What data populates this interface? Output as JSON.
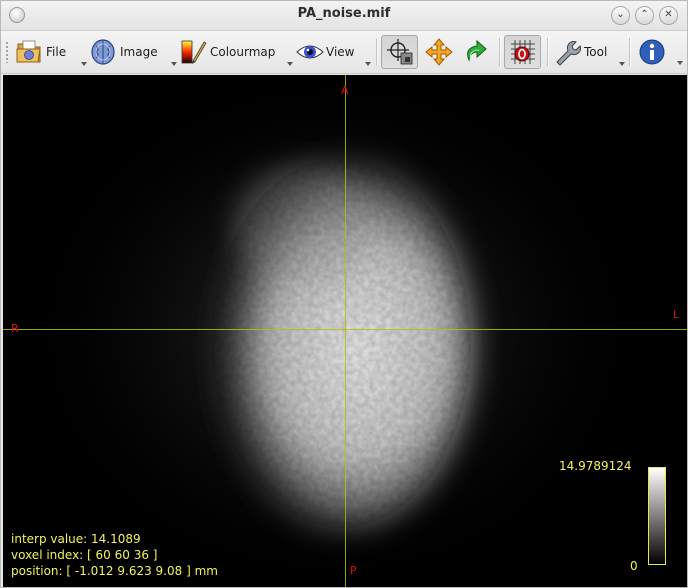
{
  "window": {
    "title": "PA_noise.mif",
    "controls": {
      "minimize": "⌄",
      "maximize": "⌃",
      "close": "✕"
    }
  },
  "toolbar": {
    "file_label": "File",
    "image_label": "Image",
    "colourmap_label": "Colourmap",
    "view_label": "View",
    "tool_label": "Tool",
    "icons": [
      "folder-icon",
      "brain-icon",
      "colourmap-icon",
      "eye-icon",
      "crosshair-icon",
      "move-icon",
      "rotate-icon",
      "roi-grid-icon",
      "wrench-icon",
      "info-icon"
    ]
  },
  "viewport": {
    "orientation": {
      "top": "A",
      "bottom": "P",
      "left": "R",
      "right": "L"
    },
    "info": {
      "interp_value": "interp value: 14.1089",
      "voxel_index": "voxel index: [ 60 60 36 ]",
      "position": "position: [ -1.012 9.623 9.08 ] mm"
    },
    "colourbar": {
      "max": "14.9789124",
      "min": "0"
    },
    "colors": {
      "crosshair": "#b8b81a",
      "overlay_text": "#f2f25a",
      "orientation_text": "#e01010"
    }
  }
}
